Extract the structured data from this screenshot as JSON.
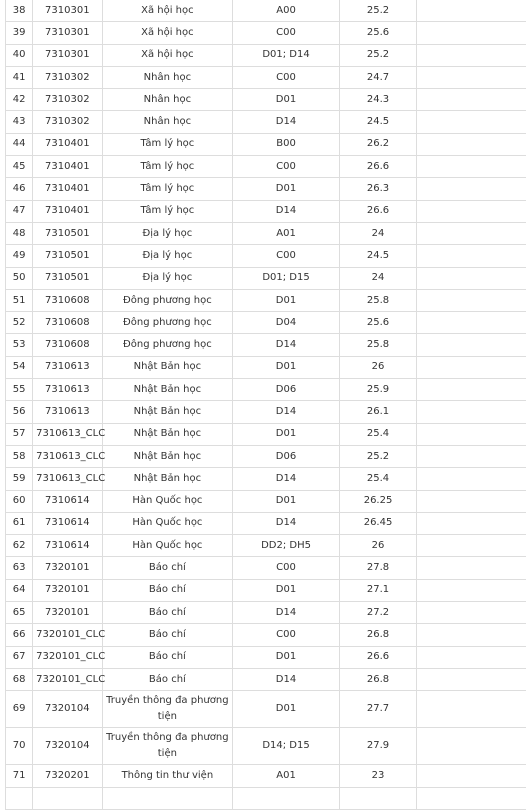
{
  "rows": [
    [
      "38",
      "7310301",
      "Xã hội học",
      "A00",
      "25.2"
    ],
    [
      "39",
      "7310301",
      "Xã hội học",
      "C00",
      "25.6"
    ],
    [
      "40",
      "7310301",
      "Xã hội học",
      "D01; D14",
      "25.2"
    ],
    [
      "41",
      "7310302",
      "Nhân học",
      "C00",
      "24.7"
    ],
    [
      "42",
      "7310302",
      "Nhân học",
      "D01",
      "24.3"
    ],
    [
      "43",
      "7310302",
      "Nhân học",
      "D14",
      "24.5"
    ],
    [
      "44",
      "7310401",
      "Tâm lý học",
      "B00",
      "26.2"
    ],
    [
      "45",
      "7310401",
      "Tâm lý học",
      "C00",
      "26.6"
    ],
    [
      "46",
      "7310401",
      "Tâm lý học",
      "D01",
      "26.3"
    ],
    [
      "47",
      "7310401",
      "Tâm lý học",
      "D14",
      "26.6"
    ],
    [
      "48",
      "7310501",
      "Địa lý học",
      "A01",
      "24"
    ],
    [
      "49",
      "7310501",
      "Địa lý học",
      "C00",
      "24.5"
    ],
    [
      "50",
      "7310501",
      "Địa lý học",
      "D01; D15",
      "24"
    ],
    [
      "51",
      "7310608",
      "Đông phương học",
      "D01",
      "25.8"
    ],
    [
      "52",
      "7310608",
      "Đông phương học",
      "D04",
      "25.6"
    ],
    [
      "53",
      "7310608",
      "Đông phương học",
      "D14",
      "25.8"
    ],
    [
      "54",
      "7310613",
      "Nhật Bản học",
      "D01",
      "26"
    ],
    [
      "55",
      "7310613",
      "Nhật Bản học",
      "D06",
      "25.9"
    ],
    [
      "56",
      "7310613",
      "Nhật Bản học",
      "D14",
      "26.1"
    ],
    [
      "57",
      "7310613_CLC",
      "Nhật Bản học",
      "D01",
      "25.4"
    ],
    [
      "58",
      "7310613_CLC",
      "Nhật Bản học",
      "D06",
      "25.2"
    ],
    [
      "59",
      "7310613_CLC",
      "Nhật Bản học",
      "D14",
      "25.4"
    ],
    [
      "60",
      "7310614",
      "Hàn Quốc học",
      "D01",
      "26.25"
    ],
    [
      "61",
      "7310614",
      "Hàn Quốc học",
      "D14",
      "26.45"
    ],
    [
      "62",
      "7310614",
      "Hàn Quốc học",
      "DD2; DH5",
      "26"
    ],
    [
      "63",
      "7320101",
      "Báo chí",
      "C00",
      "27.8"
    ],
    [
      "64",
      "7320101",
      "Báo chí",
      "D01",
      "27.1"
    ],
    [
      "65",
      "7320101",
      "Báo chí",
      "D14",
      "27.2"
    ],
    [
      "66",
      "7320101_CLC",
      "Báo chí",
      "C00",
      "26.8"
    ],
    [
      "67",
      "7320101_CLC",
      "Báo chí",
      "D01",
      "26.6"
    ],
    [
      "68",
      "7320101_CLC",
      "Báo chí",
      "D14",
      "26.8"
    ],
    [
      "69",
      "7320104",
      "Truyền thông đa phương tiện",
      "D01",
      "27.7"
    ],
    [
      "70",
      "7320104",
      "Truyền thông đa phương tiện",
      "D14; D15",
      "27.9"
    ],
    [
      "71",
      "7320201",
      "Thông tin thư viện",
      "A01",
      "23"
    ]
  ]
}
